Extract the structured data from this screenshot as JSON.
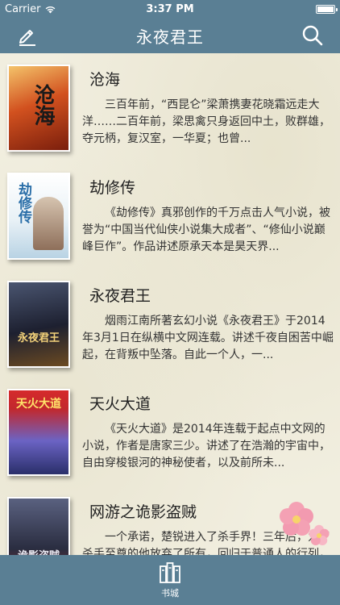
{
  "status": {
    "carrier": "Carrier",
    "time": "3:37 PM"
  },
  "nav": {
    "title": "永夜君王",
    "left_icon": "edit-icon",
    "right_icon": "search-icon"
  },
  "books": [
    {
      "title": "沧海",
      "description": "三百年前，“西昆仑”梁萧携妻花晓霜远走大洋……二百年前，梁思禽只身返回中土，败群雄，夺元柄，复汉室，一华夏；也曾...",
      "cover_text": "沧海",
      "cover_colors": [
        "#c9441c",
        "#f2b45a"
      ]
    },
    {
      "title": "劫修传",
      "description": "《劫修传》真邪创作的千万点击人气小说，被誉为“中国当代仙侠小说集大成者”、“修仙小说巅峰巨作”。作品讲述原承天本是昊天界...",
      "cover_text": "劫修传",
      "cover_colors": [
        "#ffffff",
        "#cfe3ef"
      ]
    },
    {
      "title": "永夜君王",
      "description": "烟雨江南所著玄幻小说《永夜君王》于2014年3月1日在纵横中文网连载。讲述千夜自困苦中崛起，在背叛中坠落。自此一个人，一...",
      "cover_text": "永夜君王",
      "cover_colors": [
        "#2a2f44",
        "#8a6a3a"
      ]
    },
    {
      "title": "天火大道",
      "description": "《天火大道》是2014年连载于起点中文网的小说，作者是唐家三少。讲述了在浩瀚的宇宙中，自由穿梭银河的神秘使者，以及前所未...",
      "cover_text": "天火大道",
      "cover_colors": [
        "#d2262a",
        "#5b4fa8"
      ]
    },
    {
      "title": "网游之诡影盗贼",
      "description": "一个承诺，楚锐进入了杀手界！三年后，为了杀手至尊的他放弃了所有，回归于普通人的行列，天运……整中数个国家研发的神秘游戏...",
      "cover_text": "诡影盗贼",
      "cover_colors": [
        "#3a3f5a",
        "#c0392b"
      ]
    }
  ],
  "tab_bar": {
    "label": "书城",
    "icon": "bookshelf-icon"
  }
}
